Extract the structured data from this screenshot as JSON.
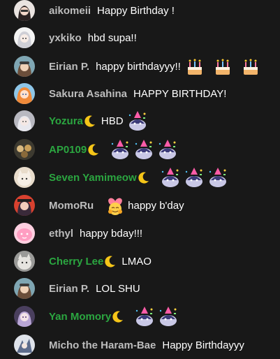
{
  "colors": {
    "background": "#181818",
    "author": "#bdbdbd",
    "member_author": "#2ba640",
    "message": "#ffffff"
  },
  "messages": [
    {
      "author": "aikomeii",
      "member": false,
      "text": "Happy Birthday !",
      "emotes": [],
      "avatar": "dark-haired-avatar"
    },
    {
      "author": "yxkiko",
      "member": false,
      "text": "hbd supa!!",
      "emotes": [],
      "avatar": "silver-hair-avatar"
    },
    {
      "author": "Eirian P.",
      "member": false,
      "text": "happy birthdayyy!!",
      "emotes": [
        "birthday-cake-emoji",
        "birthday-cake-emoji",
        "birthday-cake-emoji"
      ],
      "avatar": "goggles-avatar"
    },
    {
      "author": "Sakura Asahina",
      "member": false,
      "text": "HAPPY BIRTHDAY!",
      "emotes": [],
      "avatar": "orange-hair-avatar"
    },
    {
      "author": "Yozura",
      "member": true,
      "text": "HBD",
      "emotes": [
        "party-penguin-emote"
      ],
      "avatar": "grey-hair-avatar"
    },
    {
      "author": "AP0109",
      "member": true,
      "text": "",
      "emotes": [
        "party-penguin-emote",
        "party-penguin-emote",
        "party-penguin-emote"
      ],
      "avatar": "group-avatar"
    },
    {
      "author": "Seven Yamimeow",
      "member": true,
      "text": "",
      "emotes": [
        "party-penguin-emote",
        "party-penguin-emote",
        "party-penguin-emote"
      ],
      "avatar": "cat-avatar"
    },
    {
      "author": "MomoRu",
      "member": false,
      "text": "happy b'day",
      "emotes": [
        "heart-hug-emoji"
      ],
      "avatar": "red-avatar"
    },
    {
      "author": "ethyl",
      "member": false,
      "text": "happy bday!!!",
      "emotes": [],
      "avatar": "pink-blob-avatar"
    },
    {
      "author": "Cherry Lee",
      "member": true,
      "text": "LMAO",
      "emotes": [],
      "avatar": "cat-photo-avatar"
    },
    {
      "author": "Eirian P.",
      "member": false,
      "text": "LOL SHU",
      "emotes": [],
      "avatar": "goggles-avatar"
    },
    {
      "author": "Yan Momory",
      "member": true,
      "text": "",
      "emotes": [
        "party-penguin-emote",
        "party-penguin-emote"
      ],
      "avatar": "purple-hair-avatar"
    },
    {
      "author": "Micho the Haram-Bae",
      "member": false,
      "text": "Happy Birthdayyy",
      "emotes": [],
      "avatar": "sketch-avatar"
    }
  ]
}
